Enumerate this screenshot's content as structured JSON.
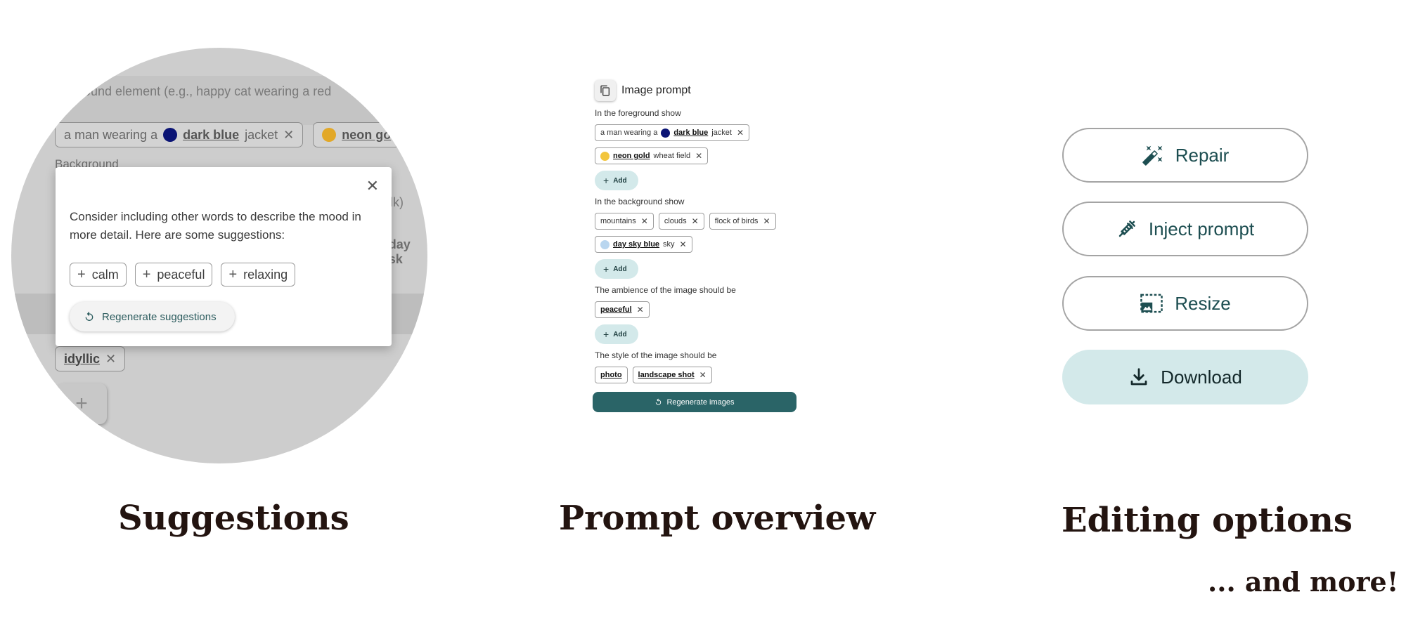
{
  "captions": {
    "suggestions": "Suggestions",
    "overview": "Prompt overview",
    "editing": "Editing options",
    "more": "... and more!"
  },
  "suggestions_panel": {
    "background": {
      "hint": "...ground element (e.g., happy cat wearing a red",
      "row1": [
        {
          "prefix": "a man wearing a",
          "color": "#0b1475",
          "color_name": "dark blue",
          "suffix": "jacket"
        },
        {
          "prefix": "",
          "color": "#e2a828",
          "color_name": "neon go",
          "suffix": ""
        }
      ],
      "label": "Background",
      "right1": "milk)",
      "right2": "day sk",
      "right2_color": "#b9d6ef",
      "idyllic": "idyllic"
    },
    "popup": {
      "text": "Consider including other words to describe the mood in more detail. Here are some suggestions:",
      "suggestions": [
        "calm",
        "peaceful",
        "relaxing"
      ],
      "regenerate_label": "Regenerate suggestions"
    }
  },
  "prompt_overview": {
    "title": "Image prompt",
    "sections": {
      "foreground": {
        "label": "In the foreground show",
        "chips": [
          {
            "prefix": "a man wearing a",
            "color": "#0b1475",
            "color_name": "dark blue",
            "suffix": "jacket"
          },
          {
            "color": "#f2c53d",
            "color_name": "neon gold",
            "suffix": "wheat field"
          }
        ],
        "add_label": "Add"
      },
      "background": {
        "label": "In the background show",
        "chips": [
          "mountains",
          "clouds",
          "flock of birds"
        ],
        "color_chip": {
          "color": "#b9d6ef",
          "color_name": "day sky blue",
          "suffix": "sky"
        },
        "add_label": "Add"
      },
      "ambience": {
        "label": "The ambience of the image should be",
        "chips": [
          "peaceful"
        ],
        "add_label": "Add"
      },
      "style": {
        "label": "The style of the image should be",
        "chips": [
          "photo",
          "landscape shot"
        ]
      }
    },
    "regenerate_label": "Regenerate images"
  },
  "editing_options": {
    "repair": "Repair",
    "inject": "Inject prompt",
    "resize": "Resize",
    "download": "Download"
  },
  "colors": {
    "accent": "#2a6467",
    "accent_light": "#d3e9ea",
    "caption": "#231410"
  }
}
